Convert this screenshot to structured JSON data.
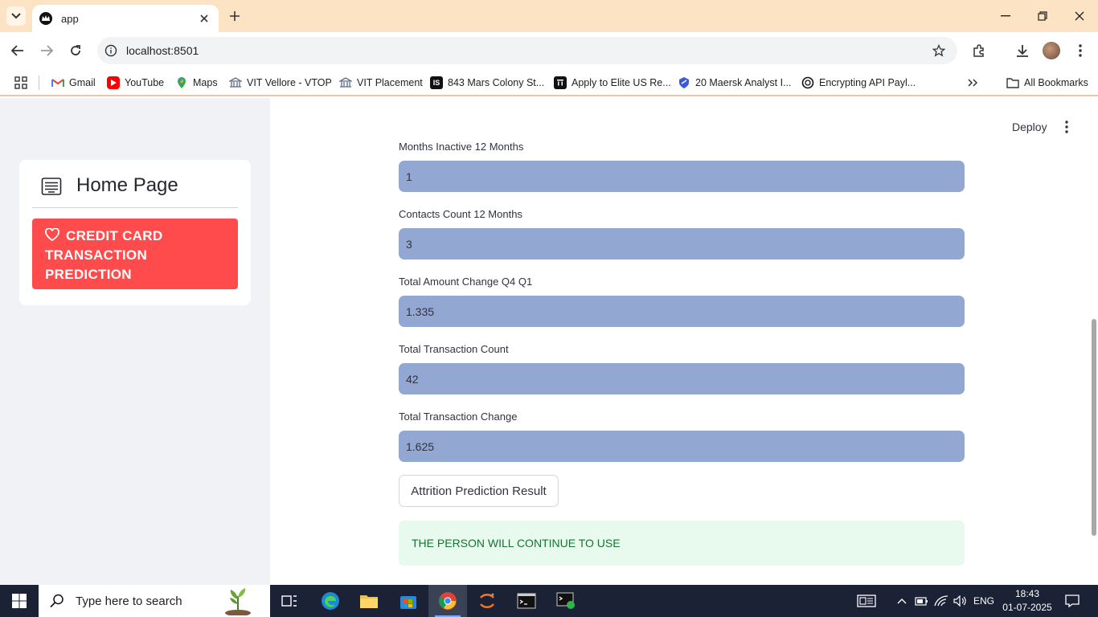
{
  "browser": {
    "tab_title": "app",
    "url": "localhost:8501",
    "bookmarks": [
      {
        "label": "Gmail",
        "icon": "gmail-icon"
      },
      {
        "label": "YouTube",
        "icon": "youtube-icon"
      },
      {
        "label": "Maps",
        "icon": "maps-icon"
      },
      {
        "label": "VIT Vellore - VTOP",
        "icon": "vit-icon"
      },
      {
        "label": "VIT Placement",
        "icon": "vit-icon"
      },
      {
        "label": "843 Mars Colony St...",
        "icon": "is-icon"
      },
      {
        "label": "Apply to Elite US Re...",
        "icon": "building-icon"
      },
      {
        "label": "20 Maersk Analyst I...",
        "icon": "shield-icon"
      },
      {
        "label": "Encrypting API Payl...",
        "icon": "openai-icon"
      }
    ],
    "all_bookmarks_label": "All Bookmarks"
  },
  "sidebar": {
    "header_title": "Home Page",
    "active_item_label": "CREDIT CARD TRANSACTION PREDICTION"
  },
  "header": {
    "deploy_label": "Deploy"
  },
  "form": {
    "fields": [
      {
        "label": "Months Inactive 12 Months",
        "value": "1"
      },
      {
        "label": "Contacts Count 12 Months",
        "value": "3"
      },
      {
        "label": "Total Amount Change Q4 Q1",
        "value": "1.335"
      },
      {
        "label": "Total Transaction Count",
        "value": "42"
      },
      {
        "label": "Total Transaction Change",
        "value": "1.625"
      }
    ],
    "submit_label": "Attrition Prediction Result",
    "result_text": "THE PERSON WILL CONTINUE TO USE"
  },
  "colors": {
    "accent": "#ff4b4b",
    "input_bg": "#92a7d2",
    "success_bg": "#e8f9ee",
    "success_text": "#177233",
    "tabstrip": "#fbe3c4"
  },
  "taskbar": {
    "search_placeholder": "Type here to search",
    "language": "ENG",
    "time": "18:43",
    "date": "01-07-2025"
  }
}
